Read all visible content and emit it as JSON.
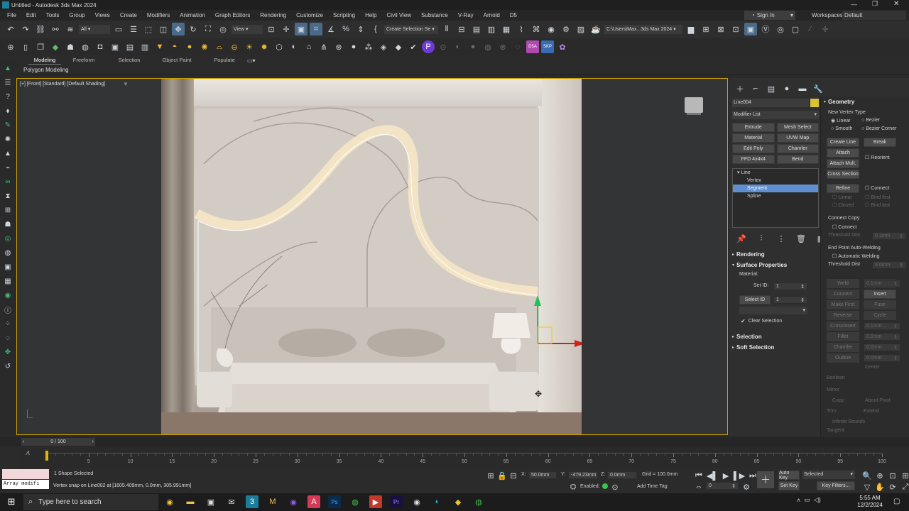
{
  "title": "Untitled - Autodesk 3ds Max 2024",
  "menu": [
    "File",
    "Edit",
    "Tools",
    "Group",
    "Views",
    "Create",
    "Modifiers",
    "Animation",
    "Graph Editors",
    "Rendering",
    "Customize",
    "Scripting",
    "Help",
    "Civil View",
    "Substance",
    "V-Ray",
    "Arnold",
    "D5"
  ],
  "signin": "Sign In",
  "workspaces_label": "Workspaces:",
  "workspaces_value": "Default",
  "toolbar": {
    "filter": "All",
    "view": "View",
    "selection_set": "Create Selection Se",
    "path": "C:\\Users\\Max...3ds Max 2024"
  },
  "ribbon": {
    "tabs": [
      "Modeling",
      "Freeform",
      "Selection",
      "Object Paint",
      "Populate"
    ],
    "sub": "Polygon Modeling"
  },
  "viewport": {
    "label": "[+] [Front] [Standard] [Default Shading]"
  },
  "panel": {
    "object_name": "Line004",
    "object_color": "#d9c13a",
    "modifier_list": "Modifier List",
    "mod_buttons": [
      "Extrude",
      "Mesh Select",
      "Material",
      "UVW Map",
      "Edit Poly",
      "Chamfer",
      "FFD 4x4x4",
      "Bend"
    ],
    "stack": [
      "Line",
      "Vertex",
      "Segment",
      "Spline"
    ],
    "rendering": "Rendering",
    "surface": "Surface Properties",
    "material": "Material:",
    "set_id": "Set ID:",
    "set_id_val": "1",
    "select_id": "Select ID",
    "select_id_val": "1",
    "clear_sel": "Clear Selection",
    "selection": "Selection",
    "soft_sel": "Soft Selection"
  },
  "geometry": {
    "title": "Geometry",
    "new_vertex_type": "New Vertex Type",
    "radios": [
      "Linear",
      "Bezier",
      "Smooth",
      "Bezier Corner"
    ],
    "create_line": "Create Line",
    "break": "Break",
    "attach": "Attach",
    "reorient": "Reorient",
    "attach_mult": "Attach Mult.",
    "cross_section": "Cross Section",
    "refine": "Refine",
    "connect": "Connect",
    "linear": "Linear",
    "bind_first": "Bind first",
    "closed": "Closed",
    "bind_last": "Bind last",
    "connect_copy": "Connect Copy",
    "connect2": "Connect",
    "threshold1": "Threshold Dist",
    "threshold1_val": "0.1mm",
    "end_weld": "End Point Auto-Welding",
    "auto_weld": "Automatic Welding",
    "threshold2": "Threshold Dist",
    "threshold2_val": "6.0mm",
    "weld": "Weld",
    "weld_val": "0.1mm",
    "connect3": "Connect",
    "insert": "Insert",
    "make_first": "Make First",
    "fuse": "Fuse",
    "reverse": "Reverse",
    "cycle": "Cycle",
    "crossinsert": "CrossInsert",
    "crossinsert_val": "0.1mm",
    "fillet": "Fillet",
    "fillet_val": "0.0mm",
    "chamfer": "Chamfer",
    "chamfer_val": "0.0mm",
    "outline": "Outline",
    "outline_val": "0.0mm",
    "center": "Center",
    "boolean": "Boolean",
    "mirror": "Mirror",
    "copy": "Copy",
    "about_pivot": "About Pivot",
    "trim": "Trim",
    "extend": "Extend",
    "infinite": "Infinite Bounds",
    "tangent": "Tangent"
  },
  "timeline": {
    "frame": "0 / 100",
    "ticks": [
      "0",
      "5",
      "10",
      "15",
      "20",
      "25",
      "30",
      "35",
      "40",
      "45",
      "50",
      "55",
      "60",
      "65",
      "70",
      "75",
      "80",
      "85",
      "90",
      "95",
      "100"
    ]
  },
  "status": {
    "maxscript": "Array modifi",
    "selected": "1 Shape Selected",
    "prompt": "Vertex snap on Line002 at [1605.409mm, 0.0mm, 305.991mm]",
    "x_label": "X:",
    "x": "50.0mm",
    "y_label": "Y:",
    "y": "-479.23mm",
    "z_label": "Z:",
    "z": "0.0mm",
    "grid": "Grid = 100.0mm",
    "enabled": "Enabled:",
    "add_time_tag": "Add Time Tag",
    "auto_key": "Auto Key",
    "selected_dd": "Selected",
    "set_key": "Set Key",
    "key_filters": "Key Filters...",
    "frame_field": "0"
  },
  "taskbar": {
    "search": "Type here to search",
    "time": "5:55 AM",
    "date": "12/2/2024"
  }
}
